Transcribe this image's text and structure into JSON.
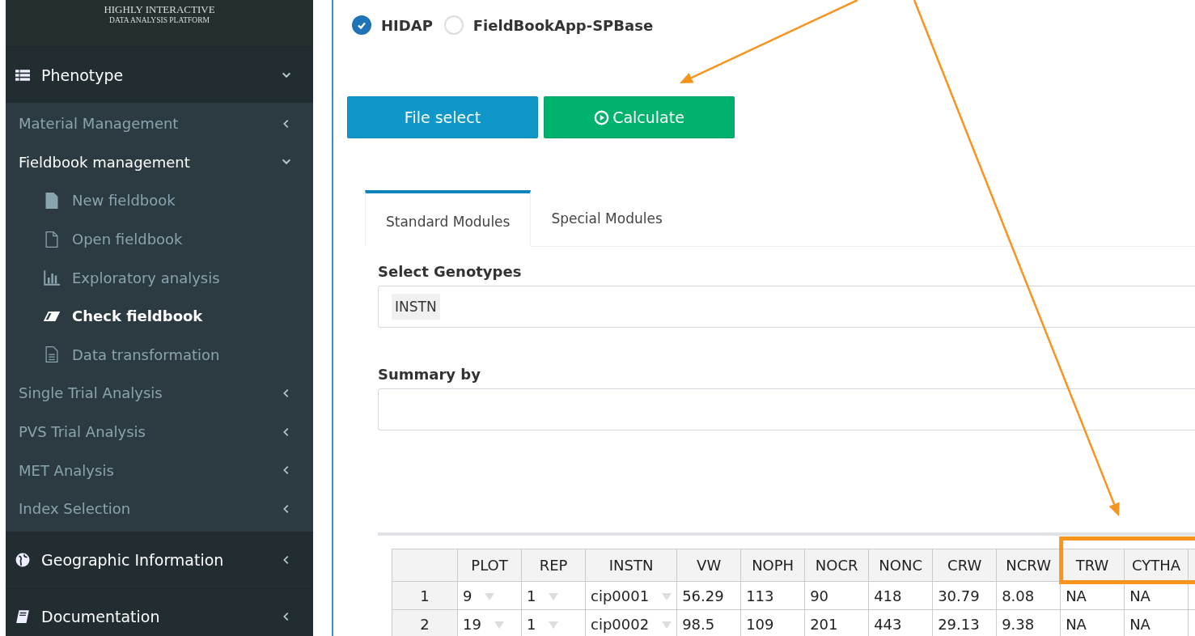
{
  "sidebar": {
    "logo": [
      "HIGHLY INTERACTIVE",
      "DATA ANALYSIS PLATFORM"
    ],
    "items": [
      {
        "label": "Phenotype",
        "expanded": true,
        "children": [
          {
            "label": "Material Management",
            "expanded": false
          },
          {
            "label": "Fieldbook management",
            "expanded": true,
            "children": [
              {
                "label": "New fieldbook",
                "selected": false
              },
              {
                "label": "Open fieldbook",
                "selected": false
              },
              {
                "label": "Exploratory analysis",
                "selected": false
              },
              {
                "label": "Check fieldbook",
                "selected": true
              },
              {
                "label": "Data transformation",
                "selected": false
              }
            ]
          },
          {
            "label": "Single Trial Analysis",
            "expanded": false
          },
          {
            "label": "PVS Trial Analysis",
            "expanded": false
          },
          {
            "label": "MET Analysis",
            "expanded": false
          },
          {
            "label": "Index Selection",
            "expanded": false
          }
        ]
      },
      {
        "label": "Geographic Information",
        "expanded": false
      },
      {
        "label": "Documentation",
        "expanded": false
      }
    ]
  },
  "source_options": [
    {
      "label": "HIDAP",
      "selected": true
    },
    {
      "label": "FieldBookApp-SPBase",
      "selected": false
    }
  ],
  "buttons": [
    {
      "label": "File select",
      "kind": "primary"
    },
    {
      "label": "Calculate",
      "kind": "success"
    }
  ],
  "tabs": [
    {
      "label": "Standard Modules",
      "selected": true
    },
    {
      "label": "Special Modules",
      "selected": false
    }
  ],
  "fields": [
    {
      "label": "Select Genotypes",
      "tags": [
        "INSTN"
      ]
    },
    {
      "label": "Summary by"
    }
  ],
  "table": {
    "columns": [
      {
        "label": "PLOT",
        "dropdown": true
      },
      {
        "label": "REP",
        "dropdown": true
      },
      {
        "label": "INSTN",
        "dropdown": true
      },
      {
        "label": "VW",
        "dropdown": false
      },
      {
        "label": "NOPH",
        "dropdown": false
      },
      {
        "label": "NOCR",
        "dropdown": false
      },
      {
        "label": "NONC",
        "dropdown": false
      },
      {
        "label": "CRW",
        "dropdown": false
      },
      {
        "label": "NCRW",
        "dropdown": false
      },
      {
        "label": "TRW",
        "dropdown": false
      },
      {
        "label": "CYTHA",
        "dropdown": false
      }
    ],
    "rows": [
      {
        "index": "1",
        "cells": [
          "9",
          "1",
          "cip0001",
          "56.29",
          "113",
          "90",
          "418",
          "30.79",
          "8.08",
          "NA",
          "NA"
        ]
      },
      {
        "index": "2",
        "cells": [
          "19",
          "1",
          "cip0002",
          "98.5",
          "109",
          "201",
          "443",
          "29.13",
          "9.38",
          "NA",
          "NA"
        ]
      }
    ]
  },
  "annotations": [
    {
      "kind": "arrow"
    },
    {
      "kind": "arrow"
    },
    {
      "kind": "highlight"
    }
  ]
}
